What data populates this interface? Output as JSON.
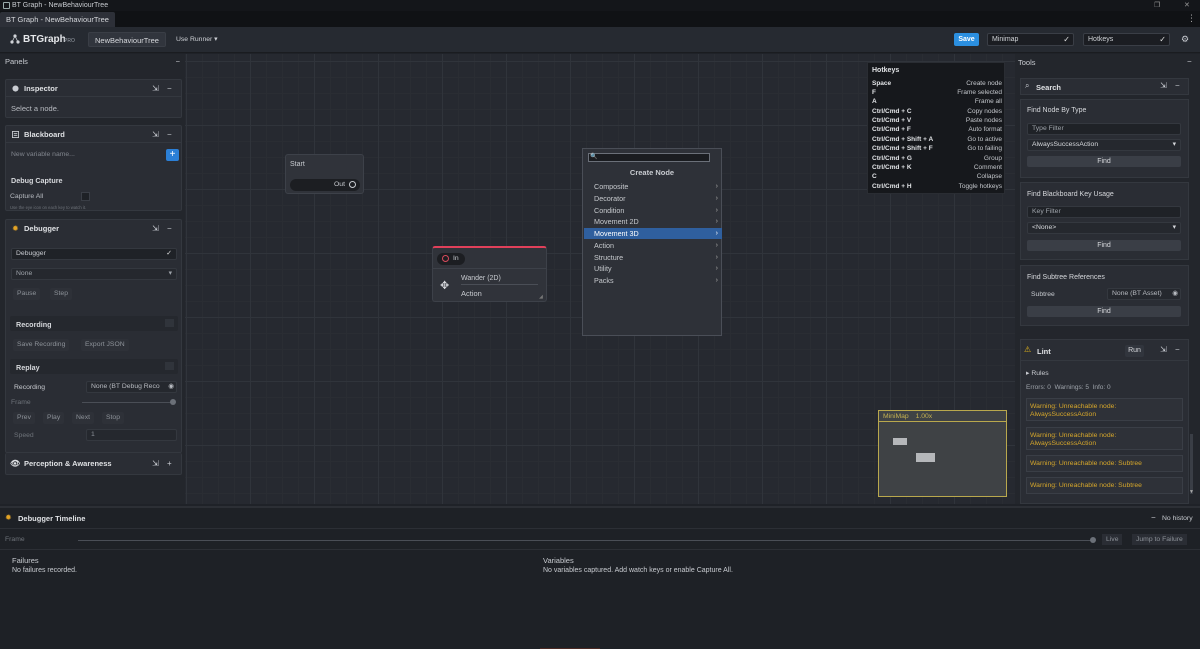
{
  "window": {
    "title": "BT Graph - NewBehaviourTree",
    "tab": "BT Graph - NewBehaviourTree"
  },
  "toolbar": {
    "brand": "BTGraph",
    "badge": "PRO",
    "asset": "NewBehaviourTree",
    "runner": "Use Runner",
    "save": "Save",
    "minimap": "Minimap",
    "hotkeys": "Hotkeys"
  },
  "panels": {
    "title": "Panels",
    "inspector": {
      "title": "Inspector",
      "hint": "Select a node."
    },
    "blackboard": {
      "title": "Blackboard",
      "placeholder": "New variable name...",
      "debug_capture": "Debug Capture",
      "capture_all": "Capture All",
      "hint": "Use the eye icon on each key to watch it."
    },
    "debugger": {
      "title": "Debugger",
      "dropdown": "Debugger",
      "target": "None",
      "pause": "Pause",
      "step": "Step",
      "recording_title": "Recording",
      "save_recording": "Save Recording",
      "export_json": "Export JSON",
      "replay_title": "Replay",
      "recording_label": "Recording",
      "recording_value": "None (BT Debug Reco",
      "frame": "Frame",
      "prev": "Prev",
      "play": "Play",
      "next": "Next",
      "stop": "Stop",
      "speed": "Speed",
      "speed_value": "1"
    },
    "perception": {
      "title": "Perception & Awareness"
    }
  },
  "canvas": {
    "start_node": {
      "title": "Start",
      "port": "Out"
    },
    "wander_node": {
      "port": "In",
      "name": "Wander (2D)",
      "type": "Action"
    }
  },
  "create_node": {
    "title": "Create Node",
    "items": [
      "Composite",
      "Decorator",
      "Condition",
      "Movement 2D",
      "Movement 3D",
      "Action",
      "Structure",
      "Utility",
      "Packs"
    ],
    "selected": "Movement 3D"
  },
  "hotkeys": {
    "title": "Hotkeys",
    "rows": [
      {
        "key": "Space",
        "action": "Create node"
      },
      {
        "key": "F",
        "action": "Frame selected"
      },
      {
        "key": "A",
        "action": "Frame all"
      },
      {
        "key": "Ctrl/Cmd + C",
        "action": "Copy nodes"
      },
      {
        "key": "Ctrl/Cmd + V",
        "action": "Paste nodes"
      },
      {
        "key": "Ctrl/Cmd + F",
        "action": "Auto format"
      },
      {
        "key": "Ctrl/Cmd + Shift + A",
        "action": "Go to active"
      },
      {
        "key": "Ctrl/Cmd + Shift + F",
        "action": "Go to failing"
      },
      {
        "key": "Ctrl/Cmd + G",
        "action": "Group"
      },
      {
        "key": "Ctrl/Cmd + K",
        "action": "Comment"
      },
      {
        "key": "C",
        "action": "Collapse"
      },
      {
        "key": "Ctrl/Cmd + H",
        "action": "Toggle hotkeys"
      }
    ]
  },
  "minimap": {
    "label": "MiniMap",
    "zoom": "1.00x"
  },
  "tools": {
    "title": "Tools",
    "search": {
      "title": "Search",
      "find_by_type": "Find Node By Type",
      "type_filter": "Type Filter",
      "type_value": "AlwaysSuccessAction",
      "find": "Find",
      "find_bb": "Find Blackboard Key Usage",
      "key_filter": "Key Filter",
      "key_value": "<None>",
      "find_subtree": "Find Subtree References",
      "subtree_label": "Subtree",
      "subtree_value": "None (BT Asset)"
    },
    "lint": {
      "title": "Lint",
      "run": "Run",
      "rules": "Rules",
      "summary": "Errors: 0  Warnings: 5  Info: 0",
      "warnings": [
        "Warning: Unreachable node: AlwaysSuccessAction",
        "Warning: Unreachable node: AlwaysSuccessAction",
        "Warning: Unreachable node: Subtree",
        "Warning: Unreachable node: Subtree"
      ]
    }
  },
  "timeline": {
    "title": "Debugger Timeline",
    "history": "No history",
    "frame": "Frame",
    "live": "Live",
    "jump": "Jump to Failure",
    "failures_title": "Failures",
    "failures_text": "No failures recorded.",
    "variables_title": "Variables",
    "variables_text": "No variables captured. Add watch keys or enable Capture All."
  },
  "colors": {
    "accent": "#2b8fe0",
    "warning": "#d6a72b",
    "selection": "#2f5f9e",
    "node_active": "#e0405a"
  }
}
